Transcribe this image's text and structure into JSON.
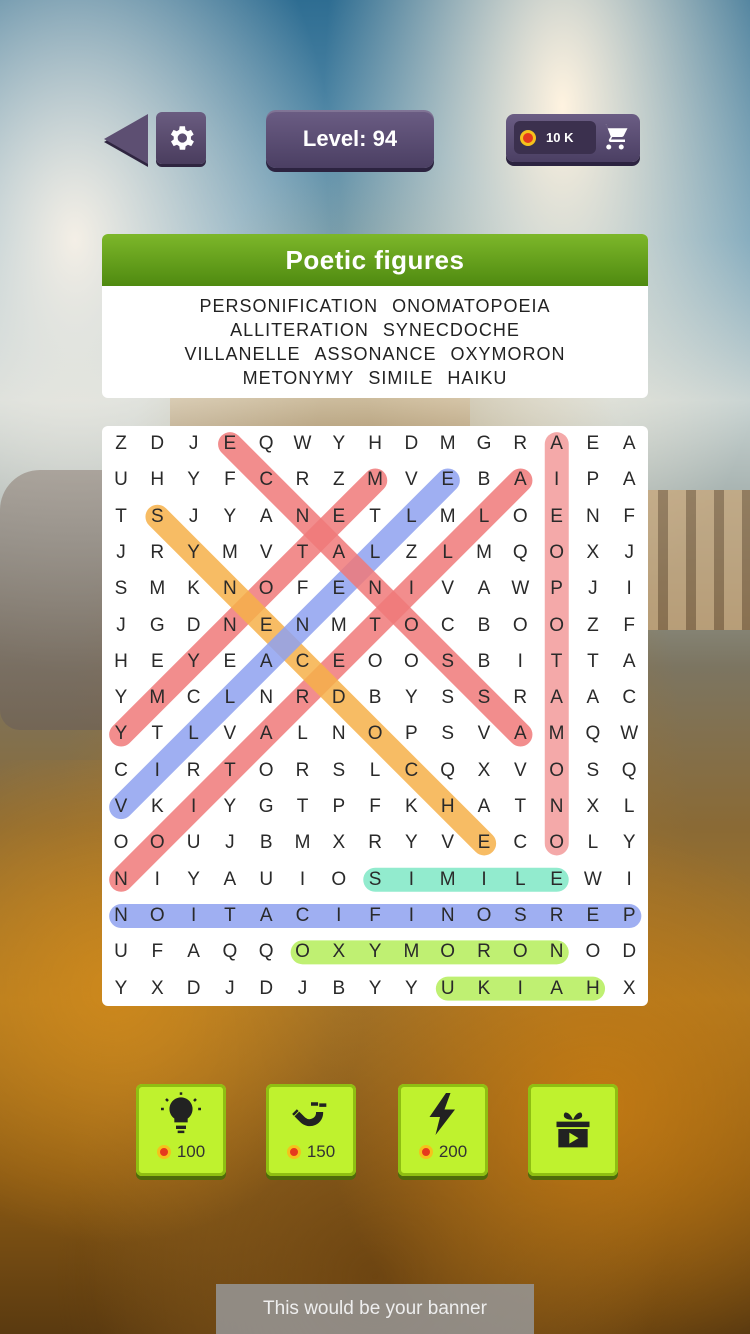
{
  "header": {
    "level_label": "Level: 94",
    "coins_label": "10 K"
  },
  "category": {
    "title": "Poetic figures",
    "word_rows": [
      [
        "PERSONIFICATION",
        "ONOMATOPOEIA"
      ],
      [
        "ALLITERATION",
        "SYNECDOCHE"
      ],
      [
        "VILLANELLE",
        "ASSONANCE",
        "OXYMORON"
      ],
      [
        "METONYMY",
        "SIMILE",
        "HAIKU"
      ]
    ]
  },
  "grid": {
    "rows": [
      "ZDJEQWYHDMGRAEA",
      "UHYFCRZMVEBAIPA",
      "TSJYANETLMLOENF",
      "JRYMVTALZLMQOXJ",
      "SMKNOFENIVAWPJI",
      "JGDNENMTOCBOOZF",
      "HEYEACEOOSBITTA",
      "YMCLNRDBYSSRAAC",
      "YTLVALNOPSVAMQW",
      "CIRTORSLCQXVOSQ",
      "VKIYGTPFKHATNXL",
      "OOUJBMXRYVECOLY",
      "NIYAUIOSIMILEWI",
      "NOITACIFINOSREP",
      "UFAQQOXYMORONOD",
      "YXDJDJBYYUKIAHX"
    ],
    "found_words": [
      {
        "word": "ALLITERATION",
        "from": [
          1,
          11
        ],
        "to": [
          12,
          0
        ],
        "color": "#f07a7a"
      },
      {
        "word": "METONYMY",
        "from": [
          1,
          7
        ],
        "to": [
          8,
          0
        ],
        "color": "#f07a7a"
      },
      {
        "word": "ONOMATOPOEIA",
        "from": [
          11,
          12
        ],
        "to": [
          0,
          12
        ],
        "color": "#f39b9b"
      },
      {
        "word": "SYNECDOCHE",
        "from": [
          2,
          1
        ],
        "to": [
          11,
          10
        ],
        "color": "#f6b14a"
      },
      {
        "word": "VILLANELLE",
        "from": [
          10,
          0
        ],
        "to": [
          1,
          9
        ],
        "color": "#8fa2f0"
      },
      {
        "word": "ASSONANCE",
        "from": [
          8,
          11
        ],
        "to": [
          0,
          3
        ],
        "color": "#f07a7a"
      },
      {
        "word": "SIMILE",
        "from": [
          12,
          7
        ],
        "to": [
          12,
          12
        ],
        "color": "#7fe8c6"
      },
      {
        "word": "PERSONIFICATION",
        "from": [
          13,
          14
        ],
        "to": [
          13,
          0
        ],
        "color": "#8fa2f0"
      },
      {
        "word": "OXYMORON",
        "from": [
          14,
          5
        ],
        "to": [
          14,
          12
        ],
        "color": "#b4ee5a"
      },
      {
        "word": "HAIKU",
        "from": [
          15,
          13
        ],
        "to": [
          15,
          9
        ],
        "color": "#b4ee5a"
      }
    ]
  },
  "boosters": [
    {
      "name": "hint",
      "icon": "lightbulb-icon",
      "price": "100"
    },
    {
      "name": "magnet",
      "icon": "magnet-icon",
      "price": "150"
    },
    {
      "name": "lightning",
      "icon": "lightning-icon",
      "price": "200"
    },
    {
      "name": "video-gift",
      "icon": "gift-video-icon",
      "price": ""
    }
  ],
  "banner": {
    "text": "This would be your banner"
  },
  "colors": {
    "header_purple": "#5d4f72",
    "title_green": "#5f9a16",
    "booster_lime": "#bff22e"
  }
}
